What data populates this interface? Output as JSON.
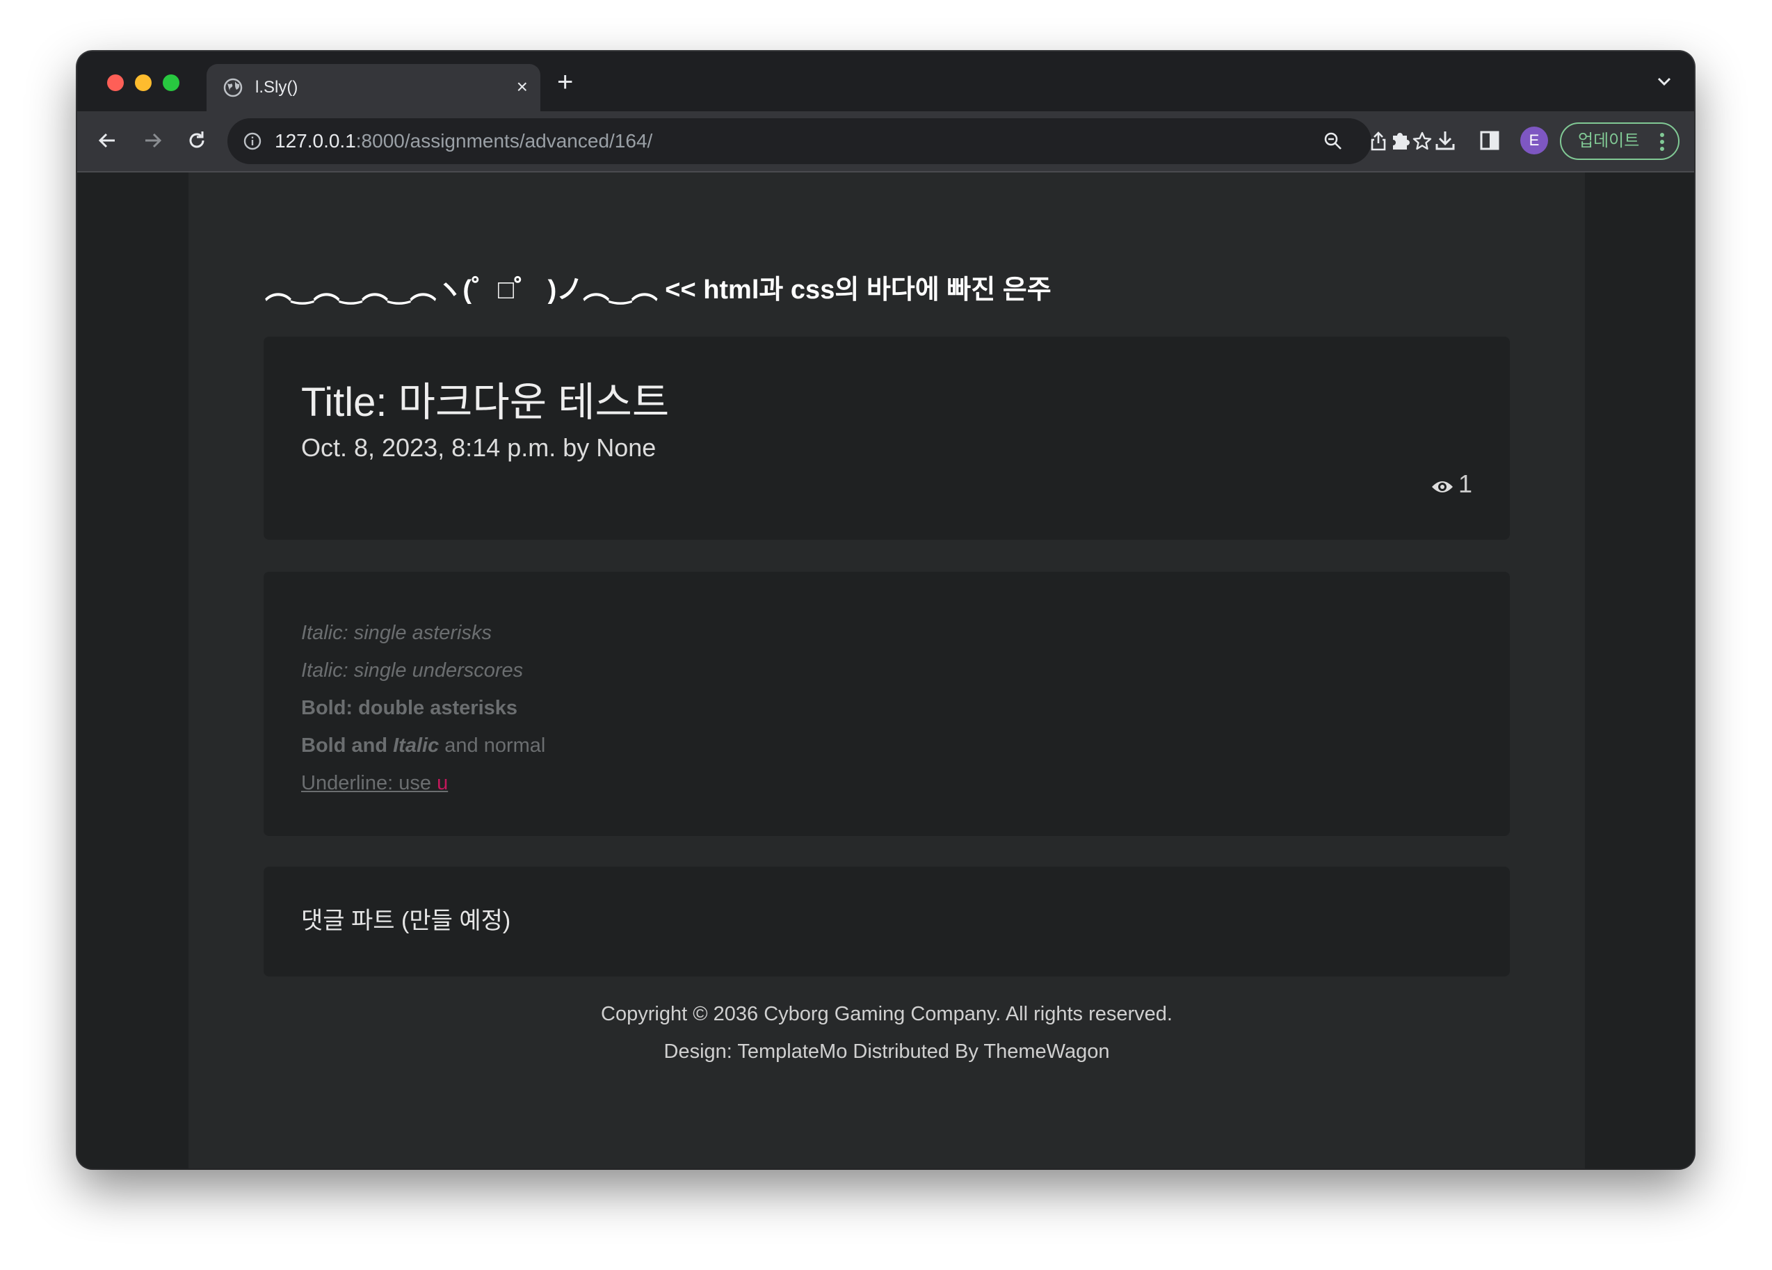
{
  "browser": {
    "tab_title": "l.Sly()",
    "tab_close": "×",
    "new_tab": "+",
    "url_host": "127.0.0.1",
    "url_rest": ":8000/assignments/advanced/164/",
    "avatar_letter": "E",
    "update_label": "업데이트"
  },
  "page": {
    "header": "︵‿︵‿︵‿︵ヽ(゜□゜ )ノ︵‿︵ << html과 css의 바다에 빠진 은주",
    "post": {
      "title": "Title: 마크다운 테스트",
      "meta": "Oct. 8, 2023, 8:14 p.m. by None",
      "views": "1"
    },
    "markdown": {
      "line1": "Italic: single asterisks",
      "line2": "Italic: single underscores",
      "line3": "Bold: double asterisks",
      "line4_bold": "Bold and ",
      "line4_bold_italic": "Italic",
      "line4_normal": " and normal",
      "line5_text": "Underline: use ",
      "line5_code": "u"
    },
    "comments": "댓글 파트 (만들 예정)",
    "footer": {
      "copyright": "Copyright © 2036 Cyborg Gaming Company. All rights reserved.",
      "design": "Design: TemplateMo Distributed By ThemeWagon"
    }
  }
}
